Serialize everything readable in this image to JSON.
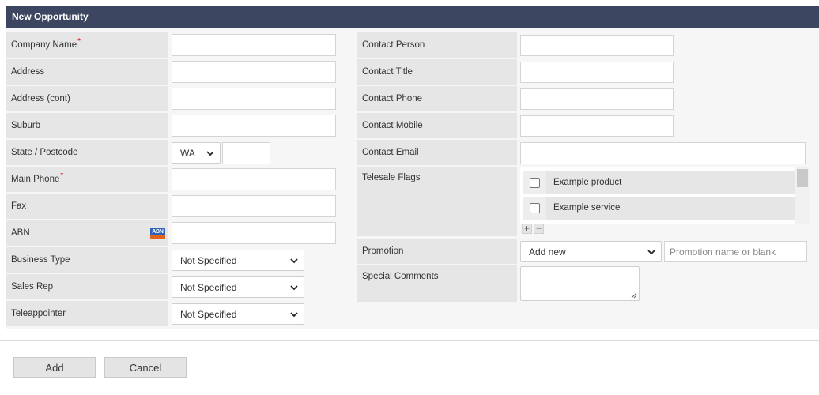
{
  "title": "New Opportunity",
  "required_marker": "*",
  "left_labels": {
    "company_name": "Company Name",
    "address": "Address",
    "address_cont": "Address (cont)",
    "suburb": "Suburb",
    "state_postcode": "State / Postcode",
    "main_phone": "Main Phone",
    "fax": "Fax",
    "abn": "ABN",
    "business_type": "Business Type",
    "sales_rep": "Sales Rep",
    "teleappointer": "Teleappointer"
  },
  "left_values": {
    "company_name": "",
    "address": "",
    "address_cont": "",
    "suburb": "",
    "state": "WA",
    "postcode": "",
    "main_phone": "",
    "fax": "",
    "abn": "",
    "business_type": "Not Specified",
    "sales_rep": "Not Specified",
    "teleappointer": "Not Specified"
  },
  "abn_icon_text": "ABN",
  "right_labels": {
    "contact_person": "Contact Person",
    "contact_title": "Contact Title",
    "contact_phone": "Contact Phone",
    "contact_mobile": "Contact Mobile",
    "contact_email": "Contact Email",
    "telesale_flags": "Telesale Flags",
    "promotion": "Promotion",
    "special_comments": "Special Comments"
  },
  "right_values": {
    "contact_person": "",
    "contact_title": "",
    "contact_phone": "",
    "contact_mobile": "",
    "contact_email": "",
    "promotion_select": "Add new",
    "promotion_placeholder": "Promotion name or blank",
    "special_comments": ""
  },
  "telesale_flags": [
    {
      "label": "Example product",
      "checked": false
    },
    {
      "label": "Example service",
      "checked": false
    }
  ],
  "flag_controls": {
    "add": "+",
    "remove": "−"
  },
  "buttons": {
    "add": "Add",
    "cancel": "Cancel"
  },
  "colors": {
    "header_bg": "#3d4660",
    "label_bg": "#e6e6e6",
    "required": "#dd0000"
  }
}
